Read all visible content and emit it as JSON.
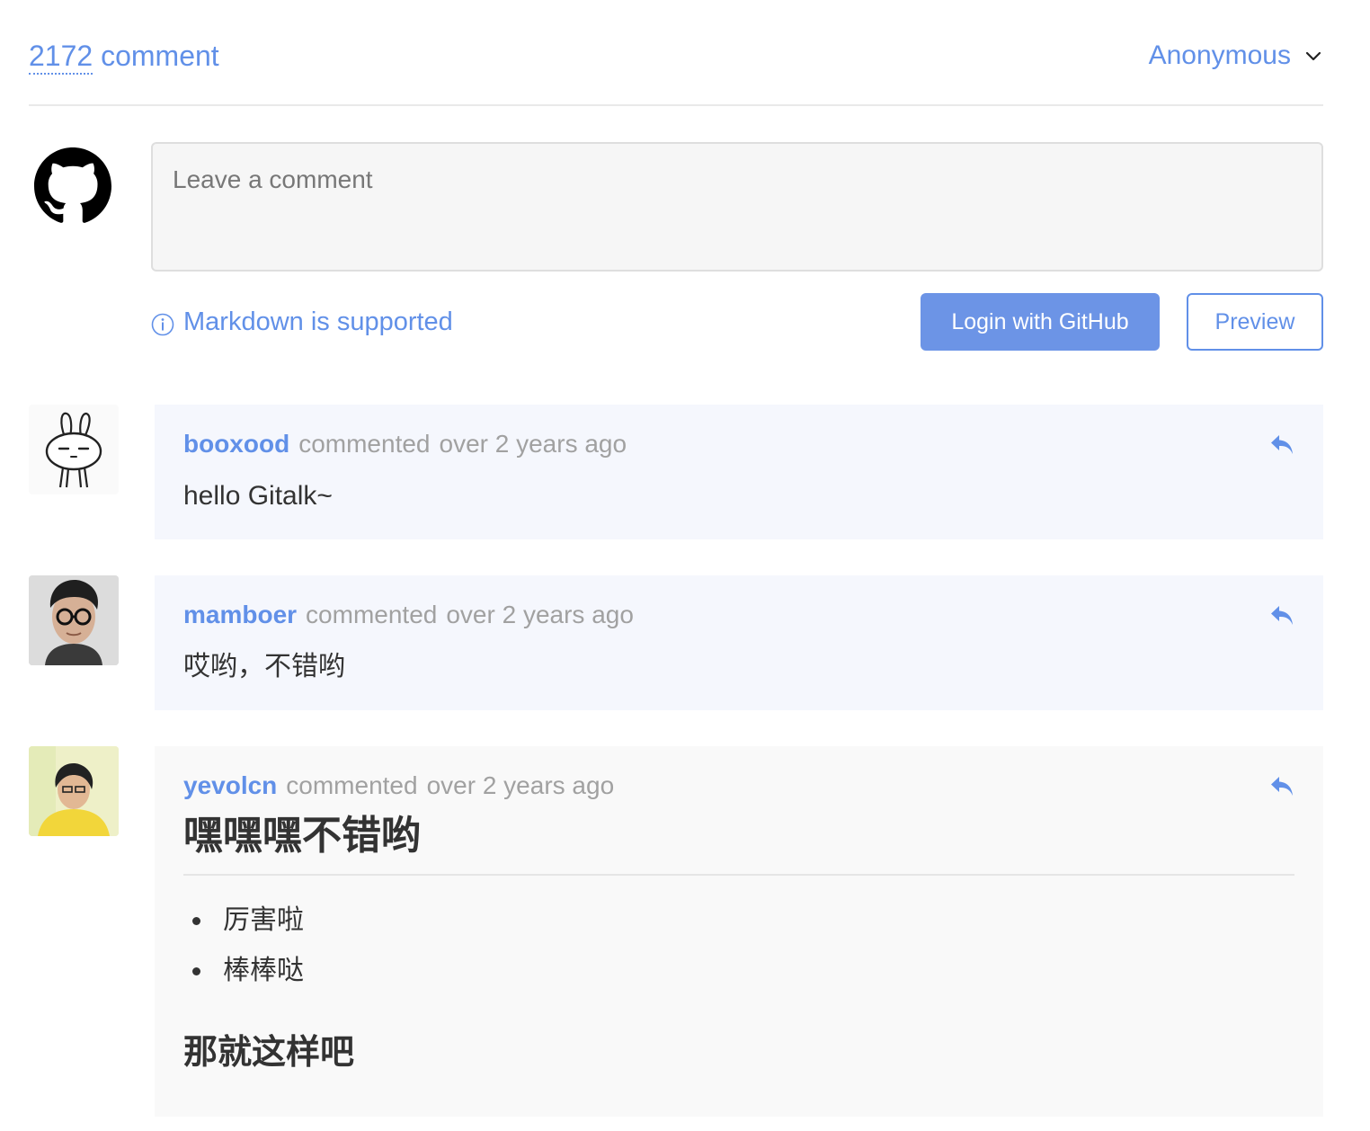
{
  "header": {
    "comment_count": "2172",
    "comment_label": " comment",
    "user_menu_label": "Anonymous"
  },
  "editor": {
    "placeholder": "Leave a comment",
    "markdown_tip": "Markdown is supported",
    "login_button": "Login with GitHub",
    "preview_button": "Preview"
  },
  "comments": [
    {
      "username": "booxood",
      "action": "commented",
      "time": "over 2 years ago",
      "body": "hello Gitalk~",
      "avatar": "rabbit-avatar"
    },
    {
      "username": "mamboer",
      "action": "commented",
      "time": "over 2 years ago",
      "body": "哎哟，不错哟",
      "avatar": "person-glasses-avatar"
    },
    {
      "username": "yevolcn",
      "action": "commented",
      "time": "over 2 years ago",
      "heading": "嘿嘿嘿不错哟",
      "list": [
        "厉害啦",
        "棒棒哒"
      ],
      "subheading": "那就这样吧",
      "avatar": "person-yellow-avatar"
    }
  ],
  "colors": {
    "accent": "#6190e8",
    "button_bg": "#6c94e6",
    "comment_bg": "#f5f7fd",
    "comment_bg_alt": "#f9f9f9",
    "meta_text": "#a1a1a1"
  },
  "icons": {
    "header_avatar": "github-icon",
    "tip": "info-icon",
    "user_menu": "chevron-down-icon",
    "reply": "reply-icon"
  }
}
